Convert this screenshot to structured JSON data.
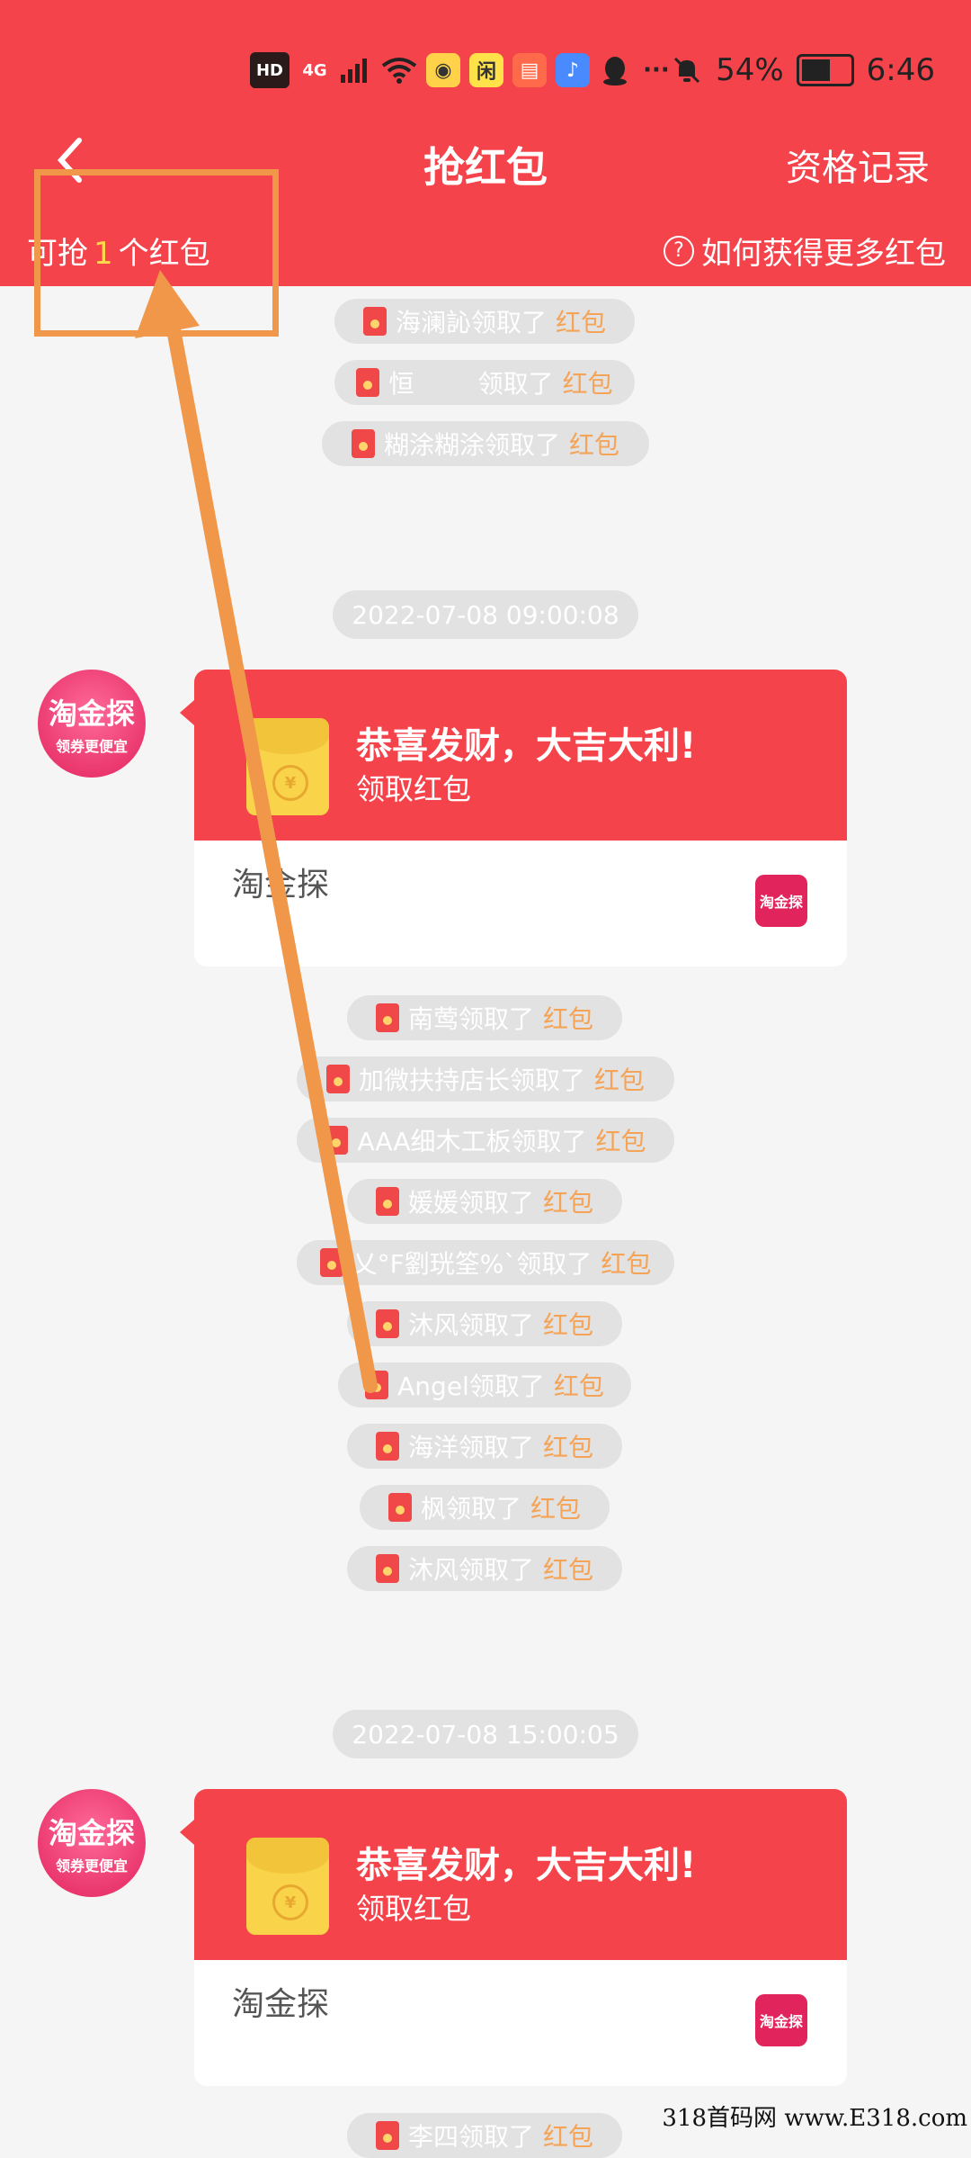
{
  "status_bar": {
    "hd": "HD",
    "network": "4G",
    "more": "···",
    "battery": "54%",
    "time": "6:46"
  },
  "nav": {
    "back_icon": "chevron-left-icon",
    "title": "抢红包",
    "right_link": "资格记录"
  },
  "sub": {
    "count_prefix": "可抢",
    "count_value": "1",
    "count_suffix": "个红包",
    "help_text": "如何获得更多红包"
  },
  "feed_top": [
    {
      "name": "海澜訫领取了",
      "tag": "红包"
    },
    {
      "name": "恒        领取了",
      "tag": "红包"
    },
    {
      "name": "糊涂糊涂领取了",
      "tag": "红包"
    }
  ],
  "time1": "2022-07-08 09:00:08",
  "card1": {
    "title": "恭喜发财，大吉大利!",
    "sub": "领取红包",
    "from": "淘金探",
    "logo": "淘金探",
    "avatar_main": "淘金探",
    "avatar_sub": "领券更便宜"
  },
  "feed_mid": [
    {
      "name": "南莺领取了",
      "tag": "红包"
    },
    {
      "name": "加微扶持店长领取了",
      "tag": "红包"
    },
    {
      "name": "AAA细木工板领取了",
      "tag": "红包"
    },
    {
      "name": "媛媛领取了",
      "tag": "红包"
    },
    {
      "name": "乂°F劉珖筌%`领取了",
      "tag": "红包"
    },
    {
      "name": "沐风领取了",
      "tag": "红包"
    },
    {
      "name": "Angel领取了",
      "tag": "红包"
    },
    {
      "name": "海洋领取了",
      "tag": "红包"
    },
    {
      "name": "枫领取了",
      "tag": "红包"
    },
    {
      "name": "沐风领取了",
      "tag": "红包"
    }
  ],
  "time2": "2022-07-08 15:00:05",
  "card2": {
    "title": "恭喜发财，大吉大利!",
    "sub": "领取红包",
    "from": "淘金探",
    "logo": "淘金探",
    "avatar_main": "淘金探",
    "avatar_sub": "领券更便宜"
  },
  "feed_bottom": [
    {
      "name": "李四领取了",
      "tag": "红包"
    }
  ],
  "watermark": "318首码网  www.E318.com",
  "colors": {
    "primary": "#f5434b",
    "accent": "#f5a356",
    "highlight": "#f0974a"
  }
}
